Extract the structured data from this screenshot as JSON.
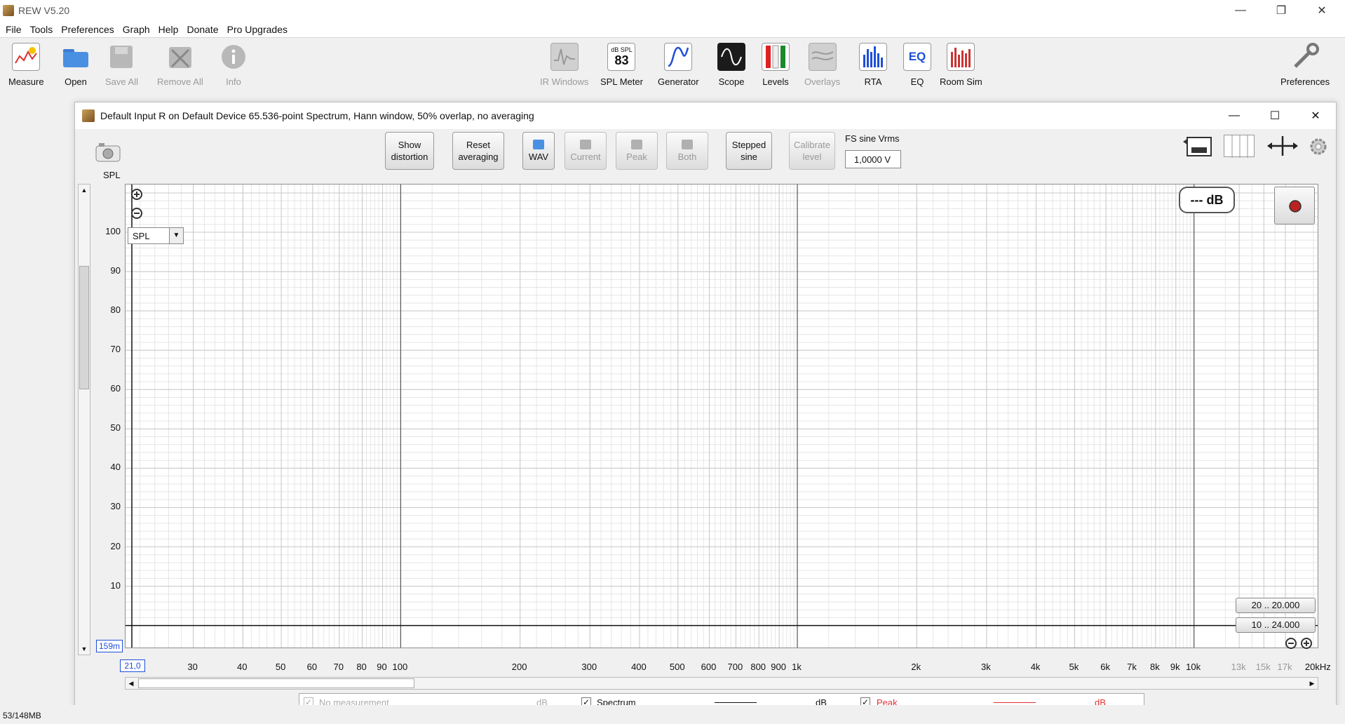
{
  "app": {
    "title": "REW V5.20"
  },
  "menu": [
    "File",
    "Tools",
    "Preferences",
    "Graph",
    "Help",
    "Donate",
    "Pro Upgrades"
  ],
  "toolbar": {
    "measure": "Measure",
    "open": "Open",
    "save_all": "Save All",
    "remove_all": "Remove All",
    "info": "Info",
    "ir_windows": "IR Windows",
    "spl_meter": "SPL Meter",
    "spl_meter_unit": "dB SPL",
    "spl_meter_value": "83",
    "generator": "Generator",
    "scope": "Scope",
    "levels": "Levels",
    "overlays": "Overlays",
    "rta": "RTA",
    "eq": "EQ",
    "eq_icon_text": "EQ",
    "room_sim": "Room Sim",
    "preferences": "Preferences"
  },
  "rta": {
    "window_title": "Default Input R on Default Device 65.536-point Spectrum, Hann window, 50% overlap, no averaging",
    "show_distortion_1": "Show",
    "show_distortion_2": "distortion",
    "reset_averaging_1": "Reset",
    "reset_averaging_2": "averaging",
    "wav": "WAV",
    "current": "Current",
    "peak": "Peak",
    "both": "Both",
    "stepped_sine_1": "Stepped",
    "stepped_sine_2": "sine",
    "calibrate_level_1": "Calibrate",
    "calibrate_level_2": "level",
    "fs_sine_label": "FS sine Vrms",
    "fs_sine_value": "1,0000 V",
    "spl_axis_label": "SPL",
    "spl_select": "SPL",
    "level_readout": "--- dB",
    "range_1": "20 .. 20.000",
    "range_2": "10 .. 24.000",
    "cursor_y": "159m",
    "cursor_x": "21,0",
    "yticks": [
      "100",
      "90",
      "80",
      "70",
      "60",
      "50",
      "40",
      "30",
      "20",
      "10"
    ],
    "xticks": [
      "30",
      "40",
      "50",
      "60",
      "70",
      "80",
      "90",
      "100",
      "200",
      "300",
      "400",
      "500",
      "600",
      "700",
      "800",
      "900",
      "1k",
      "2k",
      "3k",
      "4k",
      "5k",
      "6k",
      "7k",
      "8k",
      "9k",
      "10k",
      "13k",
      "15k",
      "17k",
      "20kHz"
    ]
  },
  "legend": {
    "no_measurement": "No measurement",
    "db1": "dB",
    "spectrum": "Spectrum",
    "db2": "dB",
    "peak": "Peak",
    "db3": "dB"
  },
  "status": {
    "memory": "53/148MB"
  },
  "colors": {
    "peak_red": "#e03030",
    "cursor_blue": "#1f4fd8",
    "grid_minor": "#e6e6e6",
    "grid_major": "#555555"
  }
}
